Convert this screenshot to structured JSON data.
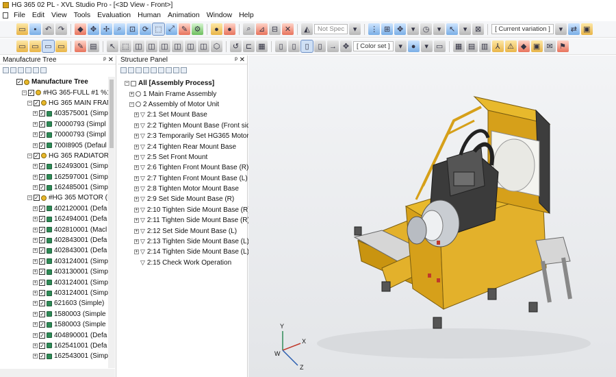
{
  "window": {
    "title": "HG 365 02 PL - XVL Studio Pro - [<3D View - Front>]"
  },
  "menu": [
    "File",
    "Edit",
    "View",
    "Tools",
    "Evaluation",
    "Human",
    "Animation",
    "Window",
    "Help"
  ],
  "toolbar": {
    "not_spec": "Not Spec",
    "current_variation": "[ Current variation ]",
    "color_set": "[ Color set ]"
  },
  "manufacture_panel": {
    "header": "Manufacture Tree",
    "rows": [
      {
        "indent": 0,
        "label": "Manufacture Tree",
        "bold": true
      },
      {
        "indent": 1,
        "label": "#HG 365-FULL #1 %1"
      },
      {
        "indent": 2,
        "label": "HG 365 MAIN FRAN"
      },
      {
        "indent": 3,
        "label": "403575001 (Simp"
      },
      {
        "indent": 3,
        "label": "70000793 (Simpl"
      },
      {
        "indent": 3,
        "label": "70000793 (Simpl"
      },
      {
        "indent": 3,
        "label": "700I8905 (Defaul"
      },
      {
        "indent": 2,
        "label": "HG 365 RADIATOR"
      },
      {
        "indent": 3,
        "label": "162493001 (Simp"
      },
      {
        "indent": 3,
        "label": "162597001 (Simp"
      },
      {
        "indent": 3,
        "label": "162485001 (Simp"
      },
      {
        "indent": 2,
        "label": "#HG 365 MOTOR (I"
      },
      {
        "indent": 3,
        "label": "402120001 (Defa"
      },
      {
        "indent": 3,
        "label": "162494001 (Defa"
      },
      {
        "indent": 3,
        "label": "402810001 (Macl"
      },
      {
        "indent": 3,
        "label": "402843001 (Defa"
      },
      {
        "indent": 3,
        "label": "402843001 (Defa"
      },
      {
        "indent": 3,
        "label": "403124001 (Simp"
      },
      {
        "indent": 3,
        "label": "403130001 (Simp"
      },
      {
        "indent": 3,
        "label": "403124001 (Simp"
      },
      {
        "indent": 3,
        "label": "403124001 (Simp"
      },
      {
        "indent": 3,
        "label": "621603 (Simple)"
      },
      {
        "indent": 3,
        "label": "1580003 (Simple"
      },
      {
        "indent": 3,
        "label": "1580003 (Simple"
      },
      {
        "indent": 3,
        "label": "404890001 (Defa"
      },
      {
        "indent": 3,
        "label": "162541001 (Defa"
      },
      {
        "indent": 3,
        "label": "162543001 (Simp"
      }
    ]
  },
  "structure_panel": {
    "header": "Structure Panel",
    "rows": [
      {
        "indent": 0,
        "label": "All [Assembly Process]",
        "bold": true
      },
      {
        "indent": 1,
        "label": "1 Main Frame Assembly"
      },
      {
        "indent": 1,
        "label": "2 Assembly of Motor Unit"
      },
      {
        "indent": 2,
        "label": "2:1 Set Mount Base"
      },
      {
        "indent": 2,
        "label": "2:2 Tighten Mount Base (Front sid"
      },
      {
        "indent": 2,
        "label": "2:3 Temporarily Set HG365 Motor"
      },
      {
        "indent": 2,
        "label": "2:4 Tighten Rear Mount Base"
      },
      {
        "indent": 2,
        "label": "2:5 Set Front Mount"
      },
      {
        "indent": 2,
        "label": "2:6 Tighten Front Mount Base (R)"
      },
      {
        "indent": 2,
        "label": "2:7 Tighten Front Mount Base (L)"
      },
      {
        "indent": 2,
        "label": "2:8 Tighten Motor Mount Base"
      },
      {
        "indent": 2,
        "label": "2:9 Set Side Mount Base (R)"
      },
      {
        "indent": 2,
        "label": "2:10 Tighten Side Mount Base (R)"
      },
      {
        "indent": 2,
        "label": "2:11 Tighten Side Mount Base (R)"
      },
      {
        "indent": 2,
        "label": "2:12 Set Side Mount Base (L)"
      },
      {
        "indent": 2,
        "label": "2:13 Tighten Side Mount Base (L) ("
      },
      {
        "indent": 2,
        "label": "2:14 Tighten Side Mount Base (L) ("
      },
      {
        "indent": 2,
        "label": "2:15 Check Work Operation"
      }
    ]
  },
  "axis": {
    "y": "Y",
    "x": "X",
    "w": "W",
    "z": "Z"
  },
  "colors": {
    "machine_yellow": "#e3b12b",
    "machine_dark": "#3a3a3a",
    "viewport_bg": "#eceef1"
  }
}
